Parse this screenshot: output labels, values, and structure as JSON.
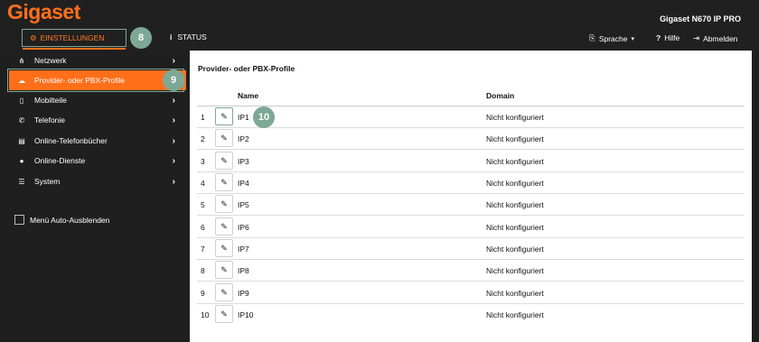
{
  "header": {
    "logo": "Gigaset",
    "device_name": "Gigaset N670 IP PRO",
    "tabs": [
      {
        "label": "EINSTELLUNGEN",
        "icon": "gears-icon"
      },
      {
        "label": "STATUS",
        "icon": "info-icon"
      }
    ],
    "language_label": "Sprache",
    "help_label": "Hilfe",
    "logout_label": "Abmelden"
  },
  "badges": {
    "b8": "8",
    "b9": "9",
    "b10": "10"
  },
  "sidebar": {
    "items": [
      {
        "label": "Netzwerk",
        "icon": "network-icon"
      },
      {
        "label": "Provider- oder PBX-Profile",
        "icon": "cloud-icon"
      },
      {
        "label": "Mobilteile",
        "icon": "handset-icon"
      },
      {
        "label": "Telefonie",
        "icon": "phone-icon"
      },
      {
        "label": "Online-Telefonbücher",
        "icon": "book-icon"
      },
      {
        "label": "Online-Dienste",
        "icon": "globe-icon"
      },
      {
        "label": "System",
        "icon": "sliders-icon"
      }
    ],
    "autohide_label": "Menü Auto-Ausblenden"
  },
  "main": {
    "title": "Provider- oder PBX-Profile",
    "col_name": "Name",
    "col_domain": "Domain",
    "rows": [
      {
        "num": "1",
        "name": "IP1",
        "domain": "Nicht konfiguriert"
      },
      {
        "num": "2",
        "name": "IP2",
        "domain": "Nicht konfiguriert"
      },
      {
        "num": "3",
        "name": "IP3",
        "domain": "Nicht konfiguriert"
      },
      {
        "num": "4",
        "name": "IP4",
        "domain": "Nicht konfiguriert"
      },
      {
        "num": "5",
        "name": "IP5",
        "domain": "Nicht konfiguriert"
      },
      {
        "num": "6",
        "name": "IP6",
        "domain": "Nicht konfiguriert"
      },
      {
        "num": "7",
        "name": "IP7",
        "domain": "Nicht konfiguriert"
      },
      {
        "num": "8",
        "name": "IP8",
        "domain": "Nicht konfiguriert"
      },
      {
        "num": "9",
        "name": "IP9",
        "domain": "Nicht konfiguriert"
      },
      {
        "num": "10",
        "name": "IP10",
        "domain": "Nicht konfiguriert"
      }
    ]
  },
  "colors": {
    "brand": "#ff6f1a",
    "badge": "#7da896",
    "background": "#1f1f1f"
  }
}
